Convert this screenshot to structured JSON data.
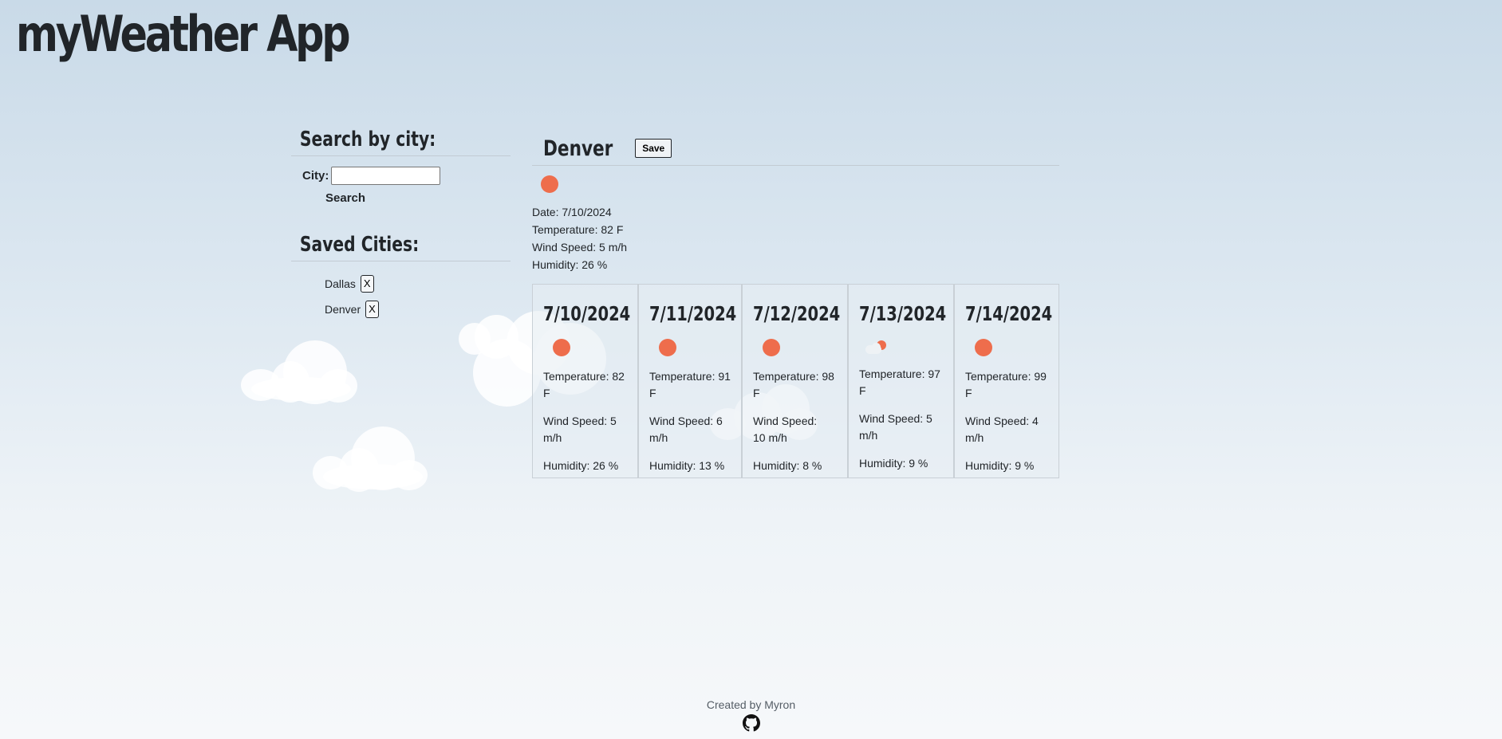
{
  "app": {
    "title": "myWeather App"
  },
  "search": {
    "heading": "Search by city:",
    "city_label": "City:",
    "input_value": "",
    "button_label": "Search"
  },
  "saved": {
    "heading": "Saved Cities:",
    "cities": [
      {
        "name": "Dallas",
        "remove_label": "X"
      },
      {
        "name": "Denver",
        "remove_label": "X"
      }
    ]
  },
  "current": {
    "city": "Denver",
    "save_label": "Save",
    "icon": "sun-icon",
    "date": "Date: 7/10/2024",
    "temperature": "Temperature: 82 F",
    "wind": "Wind Speed: 5 m/h",
    "humidity": "Humidity: 26 %"
  },
  "forecast": [
    {
      "date": "7/10/2024",
      "icon": "sun-icon",
      "temperature": "Temperature: 82 F",
      "wind": "Wind Speed: 5 m/h",
      "humidity": "Humidity: 26 %"
    },
    {
      "date": "7/11/2024",
      "icon": "sun-icon",
      "temperature": "Temperature: 91 F",
      "wind": "Wind Speed: 6 m/h",
      "humidity": "Humidity: 13 %"
    },
    {
      "date": "7/12/2024",
      "icon": "sun-icon",
      "temperature": "Temperature: 98 F",
      "wind": "Wind Speed: 10 m/h",
      "humidity": "Humidity: 8 %"
    },
    {
      "date": "7/13/2024",
      "icon": "partly-cloudy-icon",
      "temperature": "Temperature: 97 F",
      "wind": "Wind Speed: 5 m/h",
      "humidity": "Humidity: 9 %"
    },
    {
      "date": "7/14/2024",
      "icon": "sun-icon",
      "temperature": "Temperature: 99 F",
      "wind": "Wind Speed: 4 m/h",
      "humidity": "Humidity: 9 %"
    }
  ],
  "footer": {
    "credit": "Created by Myron",
    "icon": "github-icon"
  },
  "colors": {
    "sun": "#ee6d4c",
    "text": "#212529"
  }
}
